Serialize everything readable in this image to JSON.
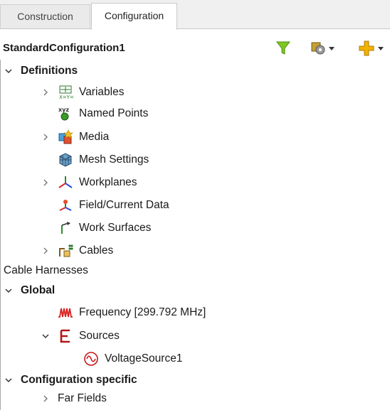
{
  "tabs": [
    {
      "label": "Construction",
      "active": false
    },
    {
      "label": "Configuration",
      "active": true
    }
  ],
  "header": {
    "title": "StandardConfiguration1",
    "tools": [
      "filter-icon",
      "gear-dropdown-icon",
      "add-dropdown-icon"
    ]
  },
  "tree": {
    "definitions": "Definitions",
    "variables": "Variables",
    "named_points": "Named Points",
    "media": "Media",
    "mesh_settings": "Mesh Settings",
    "workplanes": "Workplanes",
    "field_current_data": "Field/Current Data",
    "work_surfaces": "Work Surfaces",
    "cables": "Cables",
    "cable_harnesses": "Cable Harnesses",
    "global": "Global",
    "frequency": "Frequency [299.792 MHz]",
    "sources": "Sources",
    "voltage_source": "VoltageSource1",
    "configuration_specific": "Configuration specific",
    "far_fields": "Far Fields"
  },
  "colors": {
    "filter": "#7ec820",
    "frequency": "#d81e1e",
    "sources": "#b01818",
    "add": "#f0a800"
  }
}
